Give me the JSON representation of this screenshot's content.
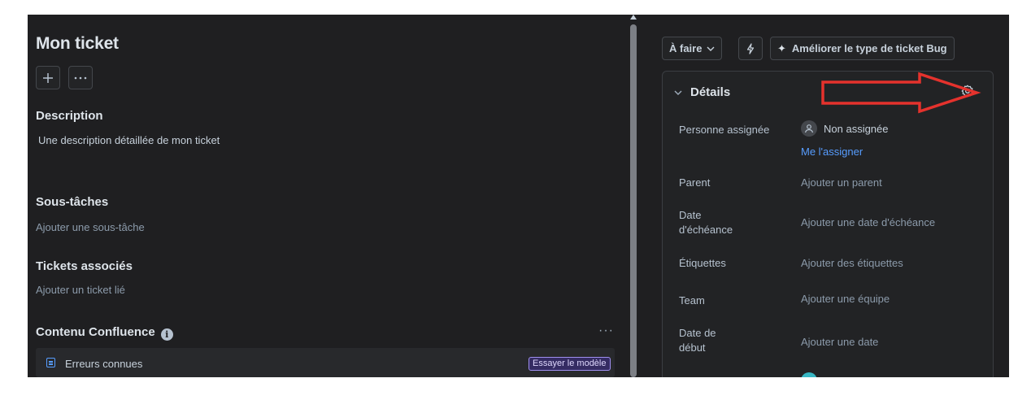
{
  "ticket": {
    "title": "Mon ticket"
  },
  "toolbar_left": {
    "add_icon": "plus-icon",
    "more_icon": "ellipsis-icon"
  },
  "description": {
    "heading": "Description",
    "text": "Une description détaillée de mon ticket"
  },
  "subtasks": {
    "heading": "Sous-tâches",
    "placeholder": "Ajouter une sous-tâche"
  },
  "linked": {
    "heading": "Tickets associés",
    "placeholder": "Ajouter un ticket lié"
  },
  "confluence": {
    "heading": "Contenu Confluence",
    "info_icon": "info-icon",
    "more_label": "···",
    "item_label": "Erreurs connues",
    "badge": "Essayer le modèle"
  },
  "right_toolbar": {
    "status": "À faire",
    "quick_action_icon": "lightning-icon",
    "improve_label": "Améliorer le type de ticket Bug"
  },
  "details": {
    "heading": "Détails",
    "settings_icon": "gear-icon",
    "fields": [
      {
        "label": "Personne assignée",
        "value": "Non assignée",
        "action": "Me l'assigner"
      },
      {
        "label": "Parent",
        "value": "Ajouter un parent"
      },
      {
        "label": "Date d'échéance",
        "value": "Ajouter une date d'échéance"
      },
      {
        "label": "Étiquettes",
        "value": "Ajouter des étiquettes"
      },
      {
        "label": "Team",
        "value": "Ajouter une équipe"
      },
      {
        "label": "Date de début",
        "value": "Ajouter une date"
      }
    ]
  },
  "colors": {
    "background": "#1f1f21",
    "link": "#579dff",
    "annotation": "#e5322d",
    "badge_border": "#9f8fef"
  }
}
